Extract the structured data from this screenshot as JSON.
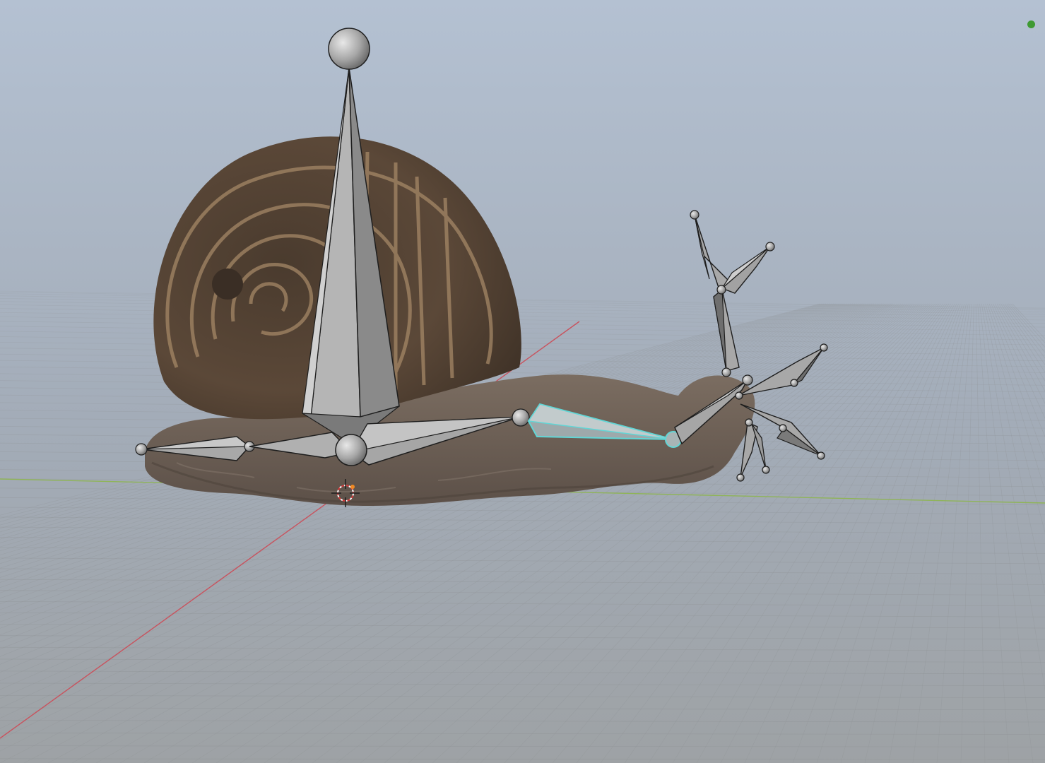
{
  "viewport": {
    "view": "3d-viewport",
    "shading": "material-preview",
    "object": "snail",
    "armature": "snail-rig"
  },
  "colors": {
    "bg_top": "#b3c0d1",
    "bg_bottom": "#9ea3a6",
    "grid_line": "#8f9396",
    "x_axis": "#c8535e",
    "y_axis": "#8fb458",
    "bone_fill": "#a4a4a4",
    "bone_light": "#c9c9c9",
    "bone_dark": "#6a6a6a",
    "bone_outline": "#1e1e1e",
    "bone_active": "#61d6d6",
    "shell_base": "#5b4838",
    "shell_stripe": "#a48766",
    "body": "#6b5e52",
    "status": "#3f9a33"
  },
  "icons": {
    "cursor": "3d-cursor-icon",
    "status": "status-dot-icon"
  }
}
